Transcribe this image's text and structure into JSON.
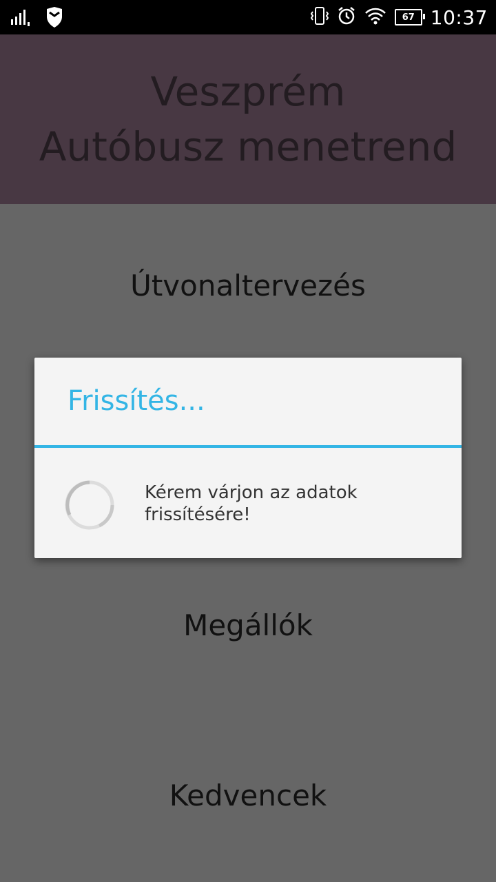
{
  "status_bar": {
    "time": "10:37",
    "battery": "67",
    "icons": [
      "signal-icon",
      "shield-icon",
      "vibrate-icon",
      "alarm-icon",
      "wifi-icon",
      "battery-icon"
    ]
  },
  "header": {
    "title_line1": "Veszprém",
    "title_line2": "Autóbusz menetrend"
  },
  "menu": {
    "items": [
      {
        "label": "Útvonaltervezés"
      },
      {
        "label": "Megállók"
      },
      {
        "label": "Kedvencek"
      }
    ]
  },
  "dialog": {
    "title": "Frissítés...",
    "message": "Kérem várjon az adatok frissítésére!"
  },
  "colors": {
    "header_bg": "#483843",
    "overlay_bg": "#666666",
    "accent": "#33b5e5"
  }
}
